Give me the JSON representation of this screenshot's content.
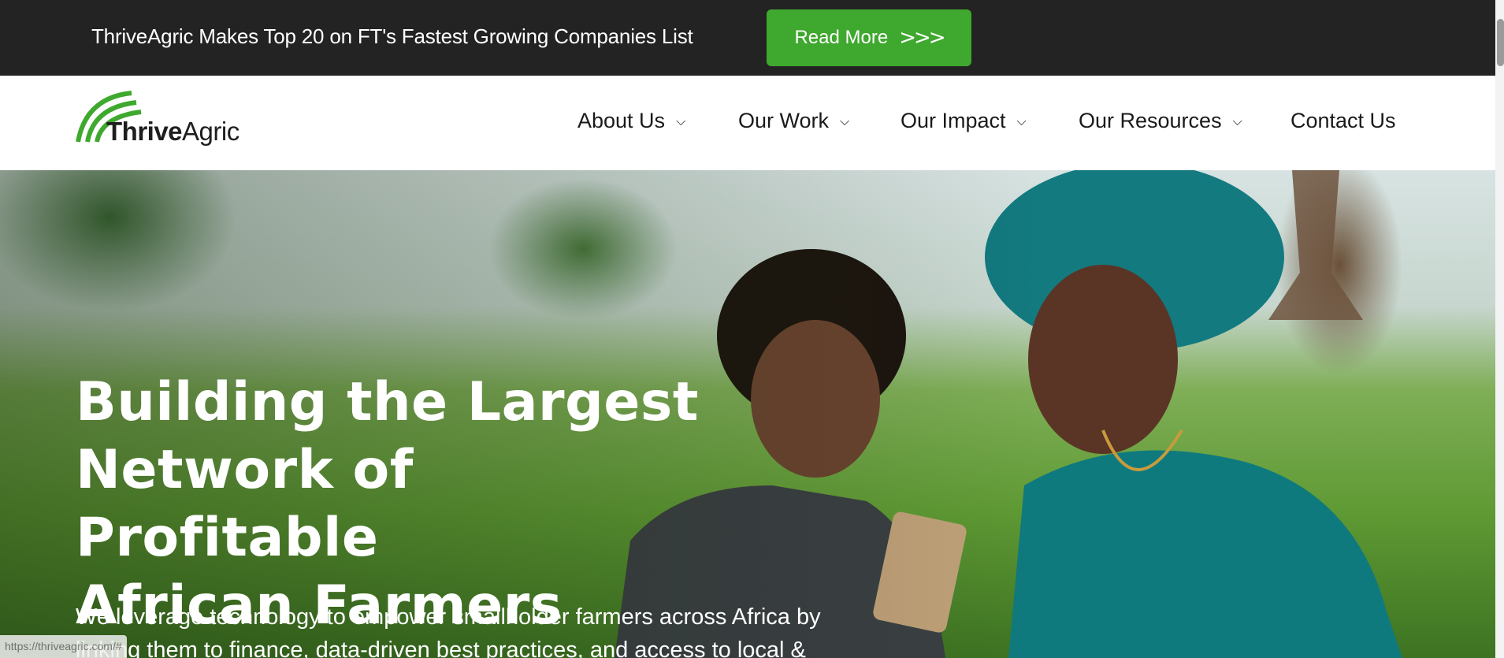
{
  "announcement": {
    "text": "ThriveAgric Makes Top 20 on FT's Fastest Growing Companies List",
    "button_label": "Read More",
    "button_arrows": ">>>"
  },
  "logo": {
    "bold": "Thrive",
    "light": "Agric"
  },
  "nav": [
    {
      "label": "About Us",
      "has_dropdown": true
    },
    {
      "label": "Our Work",
      "has_dropdown": true
    },
    {
      "label": "Our Impact",
      "has_dropdown": true
    },
    {
      "label": "Our Resources",
      "has_dropdown": true
    },
    {
      "label": "Contact Us",
      "has_dropdown": false
    }
  ],
  "hero": {
    "headline_line1": "Building the Largest",
    "headline_line2": "Network of Profitable",
    "headline_line3": "African Farmers",
    "subtext_line1": "We leverage technology to empower smallholder farmers across Africa by",
    "subtext_line2": "linking them to finance, data-driven best practices, and access to local &"
  },
  "status_bar": {
    "url": "https://thriveagric.com/#"
  },
  "colors": {
    "accent": "#3fa82e",
    "topbar": "#232323",
    "text": "#1a1a1a"
  }
}
